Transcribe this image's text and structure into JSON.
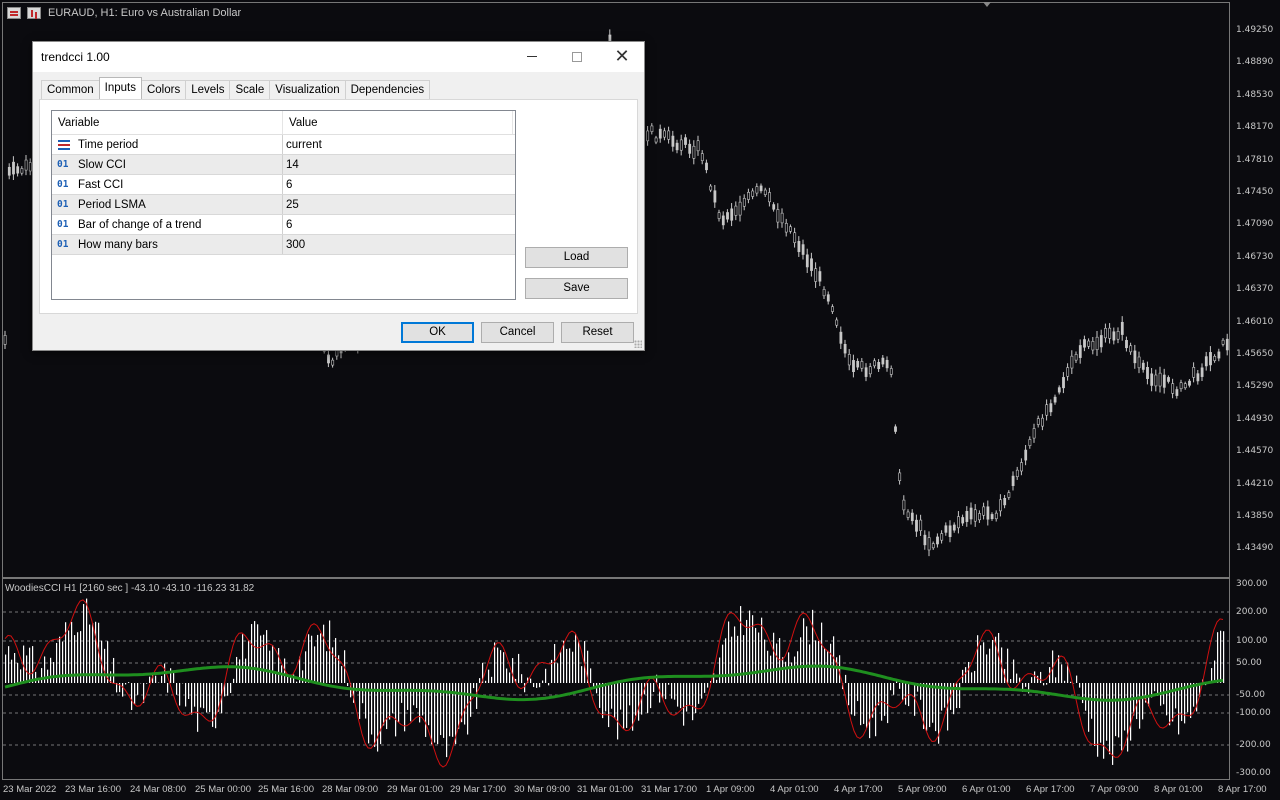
{
  "chart": {
    "title": "EURAUD, H1:  Euro vs Australian Dollar",
    "indicator_label": "WoodiesCCI H1 [2160 sec ] -43.10 -43.10 -116.23 31.82",
    "price_axis": [
      "1.49250",
      "1.48890",
      "1.48530",
      "1.48170",
      "1.47810",
      "1.47450",
      "1.47090",
      "1.46730",
      "1.46370",
      "1.46010",
      "1.45650",
      "1.45290",
      "1.44930",
      "1.44570",
      "1.44210",
      "1.43850",
      "1.43490"
    ],
    "cci_axis": [
      "300.00",
      "200.00",
      "100.00",
      "50.00",
      "-50.00",
      "-100.00",
      "-200.00",
      "-300.00"
    ],
    "time_axis": [
      "23 Mar 2022",
      "23 Mar 16:00",
      "24 Mar 08:00",
      "25 Mar 00:00",
      "25 Mar 16:00",
      "28 Mar 09:00",
      "29 Mar 01:00",
      "29 Mar 17:00",
      "30 Mar 09:00",
      "31 Mar 01:00",
      "31 Mar 17:00",
      "1 Apr 09:00",
      "4 Apr 01:00",
      "4 Apr 17:00",
      "5 Apr 09:00",
      "6 Apr 01:00",
      "6 Apr 17:00",
      "7 Apr 09:00",
      "8 Apr 01:00",
      "8 Apr 17:00"
    ],
    "colors": {
      "background": "#0b0b0f",
      "candle": "#c8c8c8",
      "cci_hist": "#ffffff",
      "trend_line": "#1f8f1f",
      "signal_line": "#d01010",
      "grid": "#9a9a9a"
    }
  },
  "dialog": {
    "title": "trendcci 1.00",
    "tabs": [
      "Common",
      "Inputs",
      "Colors",
      "Levels",
      "Scale",
      "Visualization",
      "Dependencies"
    ],
    "active_tab": "Inputs",
    "grid": {
      "headers": {
        "variable": "Variable",
        "value": "Value"
      },
      "rows": [
        {
          "icon": "list",
          "variable": "Time period",
          "value": "current"
        },
        {
          "icon": "01",
          "variable": "Slow CCI",
          "value": "14"
        },
        {
          "icon": "01",
          "variable": "Fast CCI",
          "value": "6"
        },
        {
          "icon": "01",
          "variable": "Period LSMA",
          "value": "25"
        },
        {
          "icon": "01",
          "variable": "Bar of change of a trend",
          "value": "6"
        },
        {
          "icon": "01",
          "variable": "How many bars",
          "value": "300"
        }
      ]
    },
    "buttons": {
      "load": "Load",
      "save": "Save",
      "ok": "OK",
      "cancel": "Cancel",
      "reset": "Reset"
    },
    "window_controls": {
      "minimize": "minimize",
      "maximize": "maximize",
      "close": "✕"
    }
  }
}
